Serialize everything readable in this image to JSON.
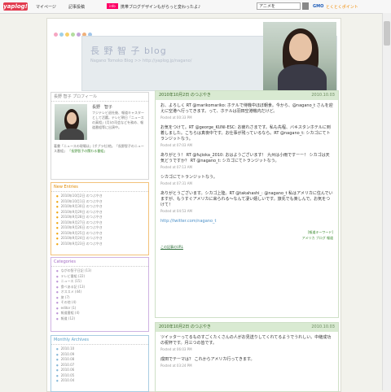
{
  "toolbar": {
    "logo": "yaplog!",
    "mypage": "マイページ",
    "newpost": "記事投稿",
    "pill": "info",
    "info_text": "携帯ブログデザインもがらっと変わったよ♪",
    "search_value": "アニメを",
    "gmo": "GMO",
    "gmo_text": "とくとくポイント"
  },
  "header": {
    "title": "長 野 智 子  blog",
    "subtitle": "Nagano Tomoko Blog >> http://yaplog.jp/nagano/"
  },
  "profile": {
    "title": "長野 智子 プロフィール",
    "name": "長野　智子",
    "desc": "フジテレビ退社後、報道キャスターとして活躍。テレビ朝日「ニュースの真相」(月)の司会などを務め、報道番組等に出演中。",
    "more": "著書「ニュースの現場は」(ポプラ社)他。「長野智子のニュース番組」",
    "more2": "「長野智子の関わる番組」"
  },
  "new_entries": {
    "title": "New Entries",
    "items": [
      "2010年10月2日 のつぶやき",
      "2010年10月1日 のつぶやき",
      "2010年9月30日 のつぶやき",
      "2010年9月29日 のつぶやき",
      "2010年9月28日 のつぶやき",
      "2010年9月27日 のつぶやき",
      "2010年9月26日 のつぶやき",
      "2010年9月25日 のつぶやき",
      "2010年9月24日 のつぶやき",
      "2010年9月23日 のつぶやき"
    ]
  },
  "categories": {
    "title": "Categories",
    "items": [
      "ながの智子日記 (13)",
      "テレビ番組 (22)",
      "ニュース (15)",
      "食べある記 (13)",
      "オススメ (44)",
      "旅 (7)",
      "その他 (4)",
      "editor (1)",
      "報道番組 (4)",
      "報道 (12)"
    ]
  },
  "archives": {
    "title": "Monthly Archives",
    "items": [
      "2010.10",
      "2010.09",
      "2010.08",
      "2010.07",
      "2010.06",
      "2010.05",
      "2010.04"
    ]
  },
  "posts": [
    {
      "title": "2010年10月2日 のつぶやき",
      "date": "2010.10.03",
      "tweets": [
        {
          "text": "お、よろしく RT @marikomariko: ホテルで待機中ほぼ朝食。今から、@nagano_t さんを迎えに空港へ行ってきます。って、ホテルは羽田空港機内だけど。",
          "posted": "Posted at 00:33 PM"
        },
        {
          "text": "お気をつけて。RT @george_KUNI-ESC: お疲れさまです。私も先程、バキスタンホテルに到着しました。こちらは真夜中です。お仕事が残っているなら。RT @nagano_t: シカゴにてトランジットなう。",
          "posted": "Posted at 07:03 AM"
        },
        {
          "text": "ありがとう！ RT @fujioka_2010: おはようございます！ 九州は小雨ですーー！ シカゴは天気どうですか？ RT @nagano_t: シカゴにてトランジットなう。",
          "posted": "Posted at 07:13 AM"
        },
        {
          "text": "シカゴにてトランジットなう。",
          "posted": "Posted at 07:31 AM"
        },
        {
          "text": "ありがとうございます。シカゴ上陸。RT @takahashi_: @nagano_t 私はアメリカに住んでいますが、もうすぐアメリカに来られる〜なんて凄い嬉しいです。旅先でも楽しんで。お気をつけて！",
          "posted": "Posted at 04:53 AM"
        }
      ],
      "link": "http://twitter.com/nagano_t",
      "tag_label": "[報道キーワード]",
      "tags": "アメリカ  ブログ  報道",
      "comment_link": "この記事のURL"
    },
    {
      "title": "2010年10月2日 のつぶやき",
      "date": "2010.10.03",
      "tweets": [
        {
          "text": "ツイッターってるものすごくたくさんの人がお見送りしてくれてるようでうれしい。中継成功の祝杯です。月三つの皆です。",
          "posted": "Posted at 06:03 PM"
        },
        {
          "text": "成田でテーマは？ これからアメリカ行ってきます。",
          "posted": "Posted at 03:24 PM"
        }
      ]
    }
  ],
  "colors": {
    "dots": [
      "#f6a6c1",
      "#9ed0e8",
      "#f7d06a",
      "#b3dd9f",
      "#c5a3da",
      "#f0b07a",
      "#a2c6ea"
    ]
  }
}
